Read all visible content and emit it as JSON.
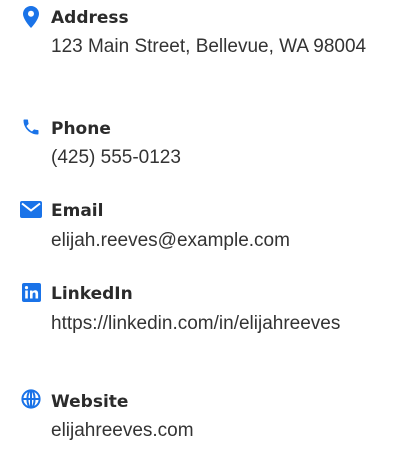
{
  "accent_color": "#1a73e8",
  "items": [
    {
      "icon": "map-pin-icon",
      "label": "Address",
      "value": "123 Main Street, Bellevue, WA 98004"
    },
    {
      "icon": "phone-icon",
      "label": "Phone",
      "value": "(425) 555-0123"
    },
    {
      "icon": "envelope-icon",
      "label": "Email",
      "value": "elijah.reeves@example.com"
    },
    {
      "icon": "linkedin-icon",
      "label": "LinkedIn",
      "value": "https://linkedin.com/in/elijahreeves"
    },
    {
      "icon": "globe-icon",
      "label": "Website",
      "value": "elijahreeves.com"
    }
  ]
}
